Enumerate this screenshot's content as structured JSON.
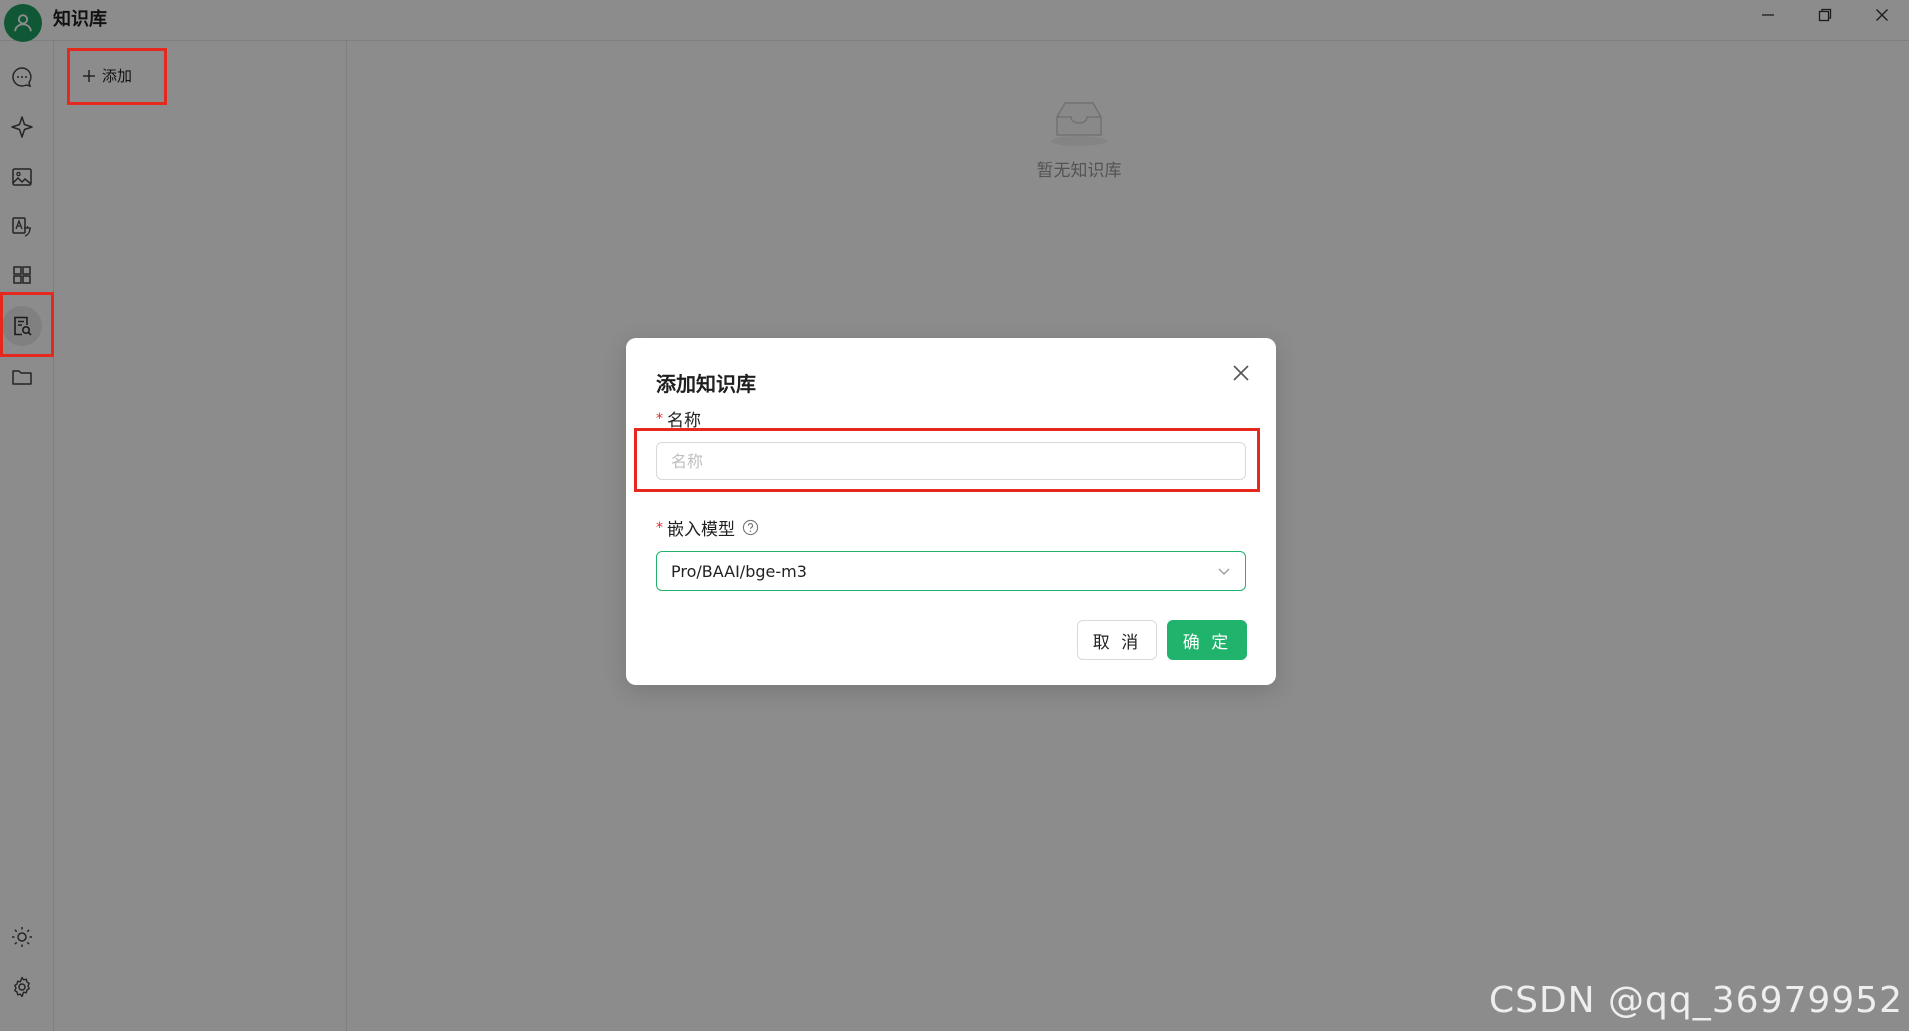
{
  "app": {
    "title": "知识库"
  },
  "list": {
    "add_label": "添加"
  },
  "main": {
    "empty_text": "暂无知识库"
  },
  "dialog": {
    "title": "添加知识库",
    "name_label": "名称",
    "name_placeholder": "名称",
    "name_value": "",
    "model_label": "嵌入模型",
    "model_value": "Pro/BAAI/bge-m3",
    "cancel_label": "取 消",
    "ok_label": "确 定"
  },
  "watermark": "CSDN @qq_36979952",
  "colors": {
    "accent": "#1fb36b",
    "highlight": "#e6291f"
  }
}
